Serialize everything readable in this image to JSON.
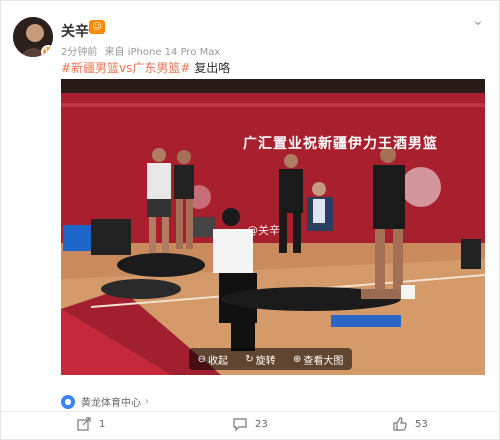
{
  "post": {
    "author": "关辛",
    "time": "2分钟前",
    "source": "来自 iPhone 14 Pro Max",
    "topic": "#新疆男篮vs广东男篮#",
    "text": " 复出咯",
    "verified_badge": "V"
  },
  "photo": {
    "banner": "广汇置业祝新疆伊力王酒男篮",
    "watermark": "@关辛"
  },
  "image_toolbar": {
    "collapse": "收起",
    "rotate": "旋转",
    "view_large": "查看大图"
  },
  "location": {
    "name": "黄龙体育中心"
  },
  "actions": {
    "share_count": "1",
    "comment_count": "23",
    "like_count": "53"
  },
  "colors": {
    "topic": "#eb7350",
    "location_icon": "#3b82f6",
    "level_icon": "#ff8a00"
  }
}
